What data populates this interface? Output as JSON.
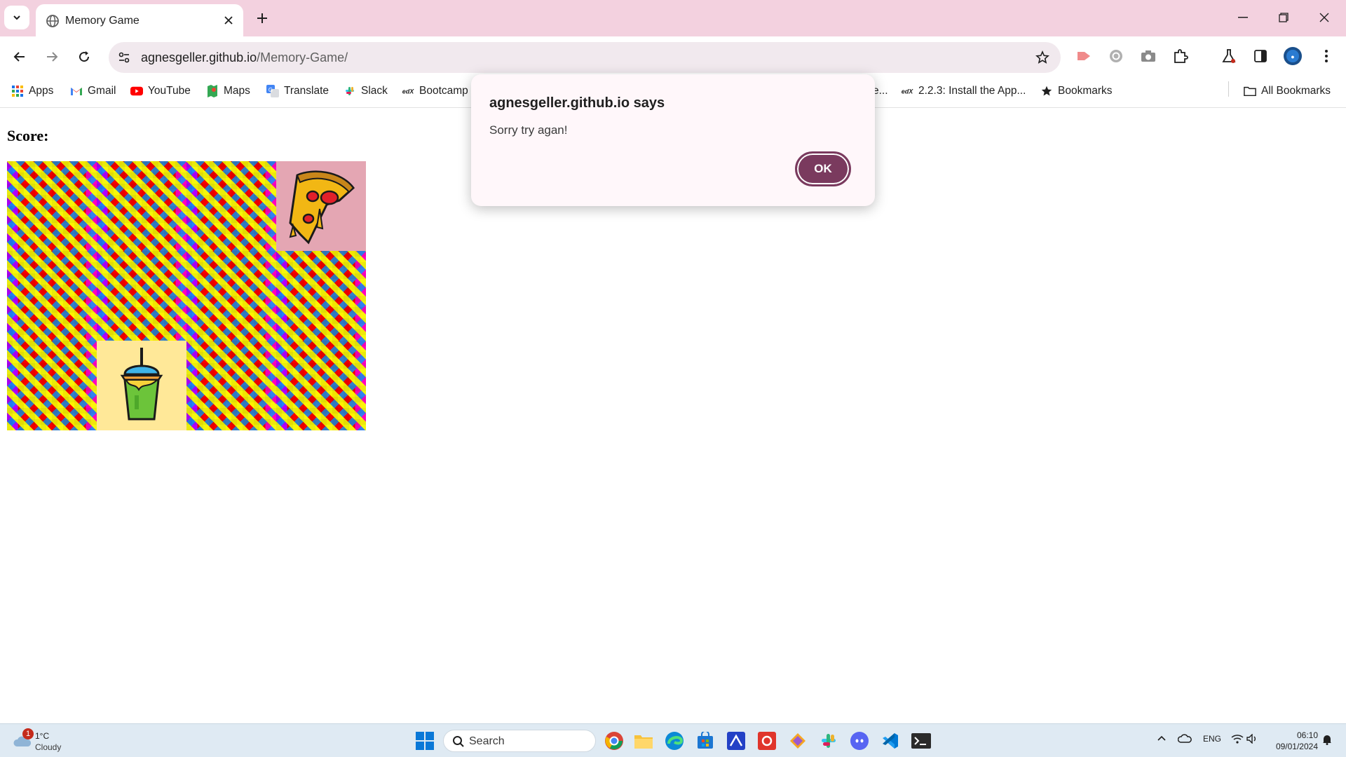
{
  "browser": {
    "tab_title": "Memory Game",
    "url_host": "agnesgeller.github.io",
    "url_path": "/Memory-Game/",
    "bookmarks": [
      {
        "label": "Apps",
        "icon": "apps-grid-icon"
      },
      {
        "label": "Gmail",
        "icon": "gmail-icon"
      },
      {
        "label": "YouTube",
        "icon": "youtube-icon"
      },
      {
        "label": "Maps",
        "icon": "maps-icon"
      },
      {
        "label": "Translate",
        "icon": "translate-icon"
      },
      {
        "label": "Slack",
        "icon": "slack-icon"
      },
      {
        "label": "Bootcamp",
        "icon": "edx-icon"
      },
      {
        "label": "e...",
        "icon": ""
      },
      {
        "label": "2.2.3: Install the App...",
        "icon": "edx-icon"
      },
      {
        "label": "Bookmarks",
        "icon": "star-icon"
      }
    ],
    "all_bookmarks": "All Bookmarks"
  },
  "page": {
    "score_label": "Score:",
    "cards": [
      "back",
      "back",
      "back",
      "pizza",
      "back",
      "back",
      "back",
      "back",
      "back",
      "drink",
      "back",
      "back"
    ]
  },
  "dialog": {
    "title": "agnesgeller.github.io says",
    "message": "Sorry try agan!",
    "ok": "OK"
  },
  "taskbar": {
    "weather_temp": "1°C",
    "weather_cond": "Cloudy",
    "weather_badge": "1",
    "search": "Search",
    "lang": "ENG",
    "time": "06:10",
    "date": "09/01/2024"
  },
  "colors": {
    "tab_strip": "#f3d1df",
    "dialog_button": "#7a3a5e",
    "pizza_card": "#e4a6b3",
    "drink_card": "#ffe898"
  }
}
